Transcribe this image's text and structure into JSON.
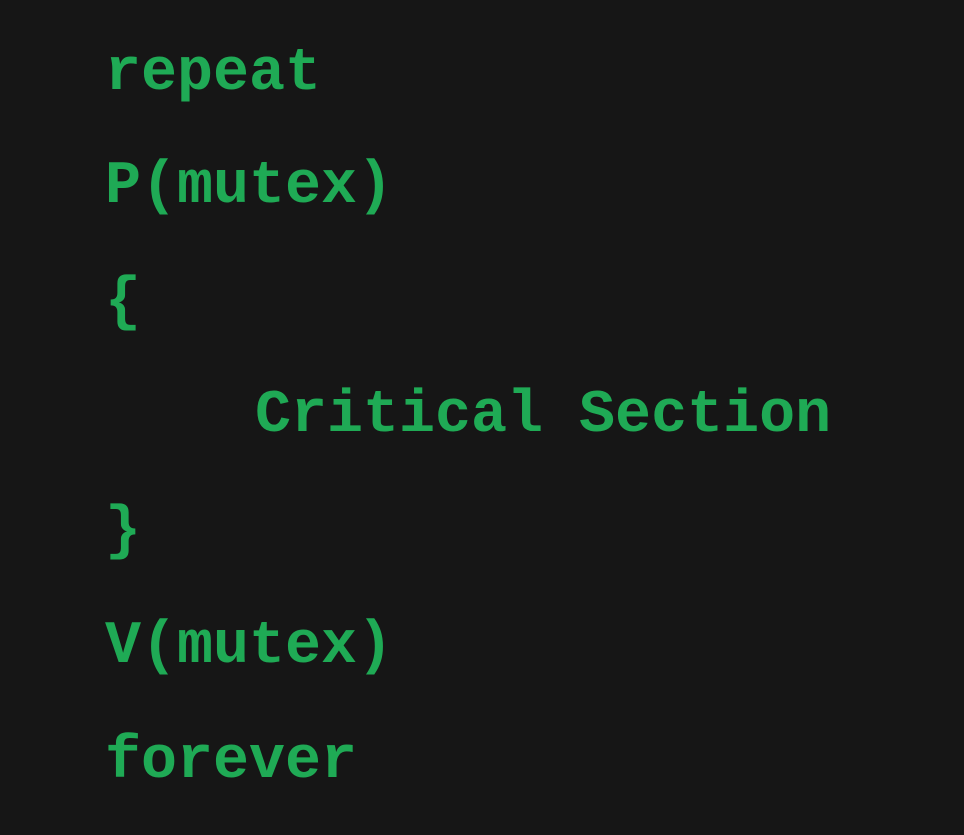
{
  "code": {
    "lines": [
      "repeat",
      "P(mutex)",
      "{",
      "Critical Section",
      "}",
      "V(mutex)",
      "forever"
    ],
    "text_color": "#1faa55",
    "background_color": "#161616"
  }
}
